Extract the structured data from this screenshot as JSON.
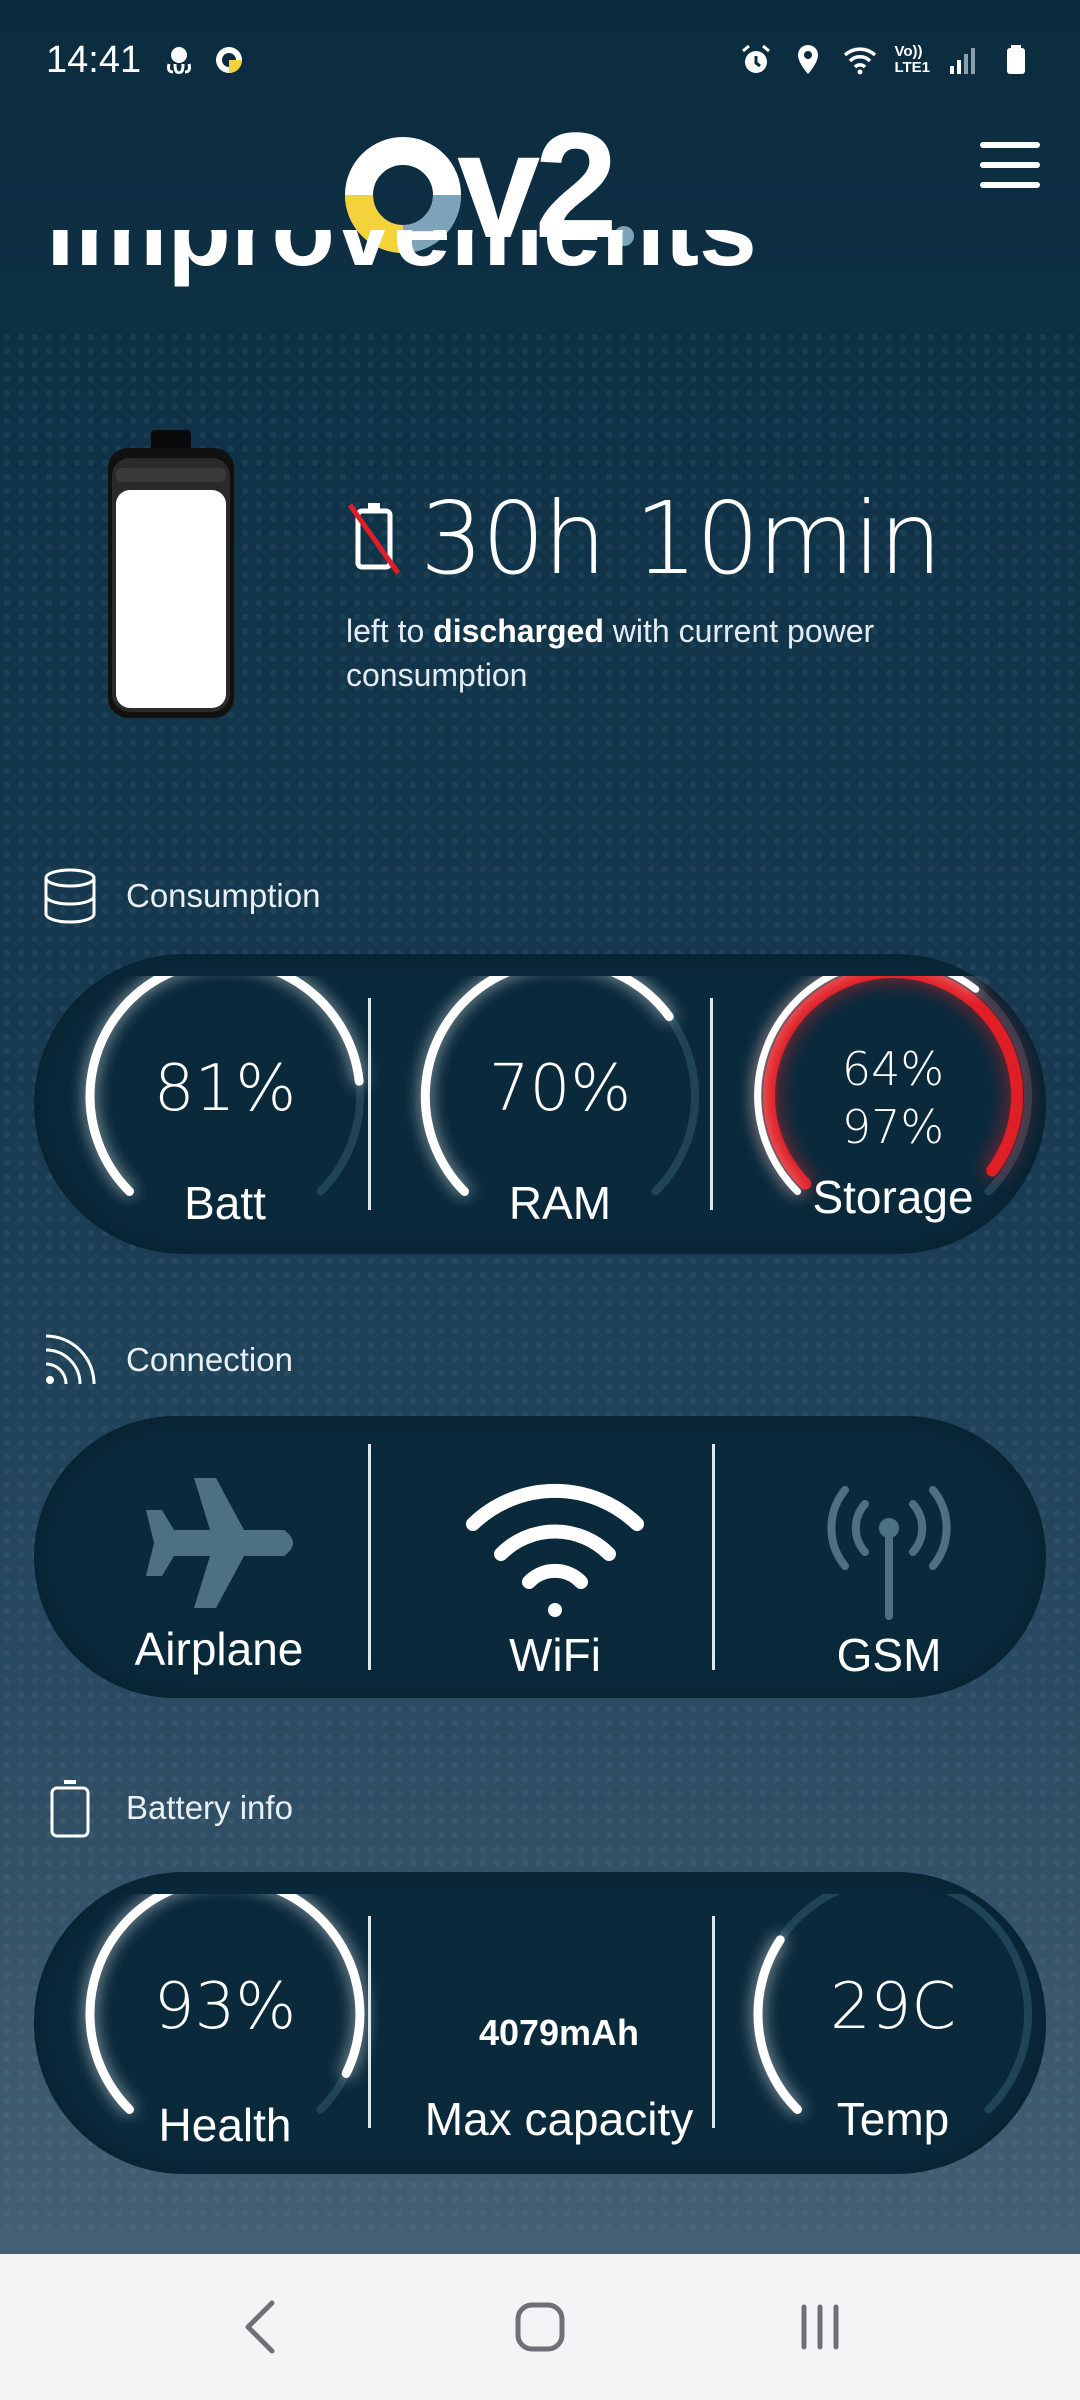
{
  "status_bar": {
    "time": "14:41",
    "left_icons": [
      "octopus-icon",
      "ring-app-icon"
    ],
    "right_icons": [
      "alarm-icon",
      "location-icon",
      "wifi-icon",
      "volte-icon",
      "signal-icon",
      "battery-icon"
    ],
    "volte_label_top": "Vo))",
    "volte_label_bottom": "LTE1"
  },
  "header": {
    "logo_text": "v2",
    "logo_letter": "O",
    "menu_icon": "hamburger-menu-icon"
  },
  "scrolled_title": "improvements",
  "discharge": {
    "time": "30h 10min",
    "text_before": "left to ",
    "text_bold": "discharged",
    "text_after": " with current power consumption",
    "icon": "battery-discharge-icon"
  },
  "sections": {
    "consumption": {
      "title": "Consumption",
      "icon": "database-icon",
      "gauges": [
        {
          "label": "Batt",
          "value": "81%",
          "fraction": 0.81
        },
        {
          "label": "RAM",
          "value": "70%",
          "fraction": 0.7
        },
        {
          "label": "Storage",
          "value": "64%",
          "value2": "97%",
          "fraction": 0.64,
          "fraction2": 0.97
        }
      ]
    },
    "connection": {
      "title": "Connection",
      "icon": "connection-signal-icon",
      "items": [
        {
          "label": "Airplane",
          "icon": "airplane-icon",
          "active": false
        },
        {
          "label": "WiFi",
          "icon": "wifi-icon",
          "active": true
        },
        {
          "label": "GSM",
          "icon": "antenna-icon",
          "active": false
        }
      ]
    },
    "battery_info": {
      "title": "Battery info",
      "icon": "battery-outline-icon",
      "health": {
        "label": "Health",
        "value": "93%",
        "fraction": 0.93
      },
      "capacity": {
        "label": "Max capacity",
        "value": "4079mAh"
      },
      "temp": {
        "label": "Temp",
        "value": "29C",
        "fraction": 0.29
      }
    }
  },
  "colors": {
    "background": "#0f3246",
    "panel": "#0a2a3c",
    "logo_yellow": "#f3d23a",
    "logo_grey": "#7da4b8",
    "storage_red": "#e01e25",
    "inactive_icon": "#4d7180"
  },
  "nav_bar": {
    "buttons": [
      "back-icon",
      "home-icon",
      "recents-icon"
    ]
  }
}
